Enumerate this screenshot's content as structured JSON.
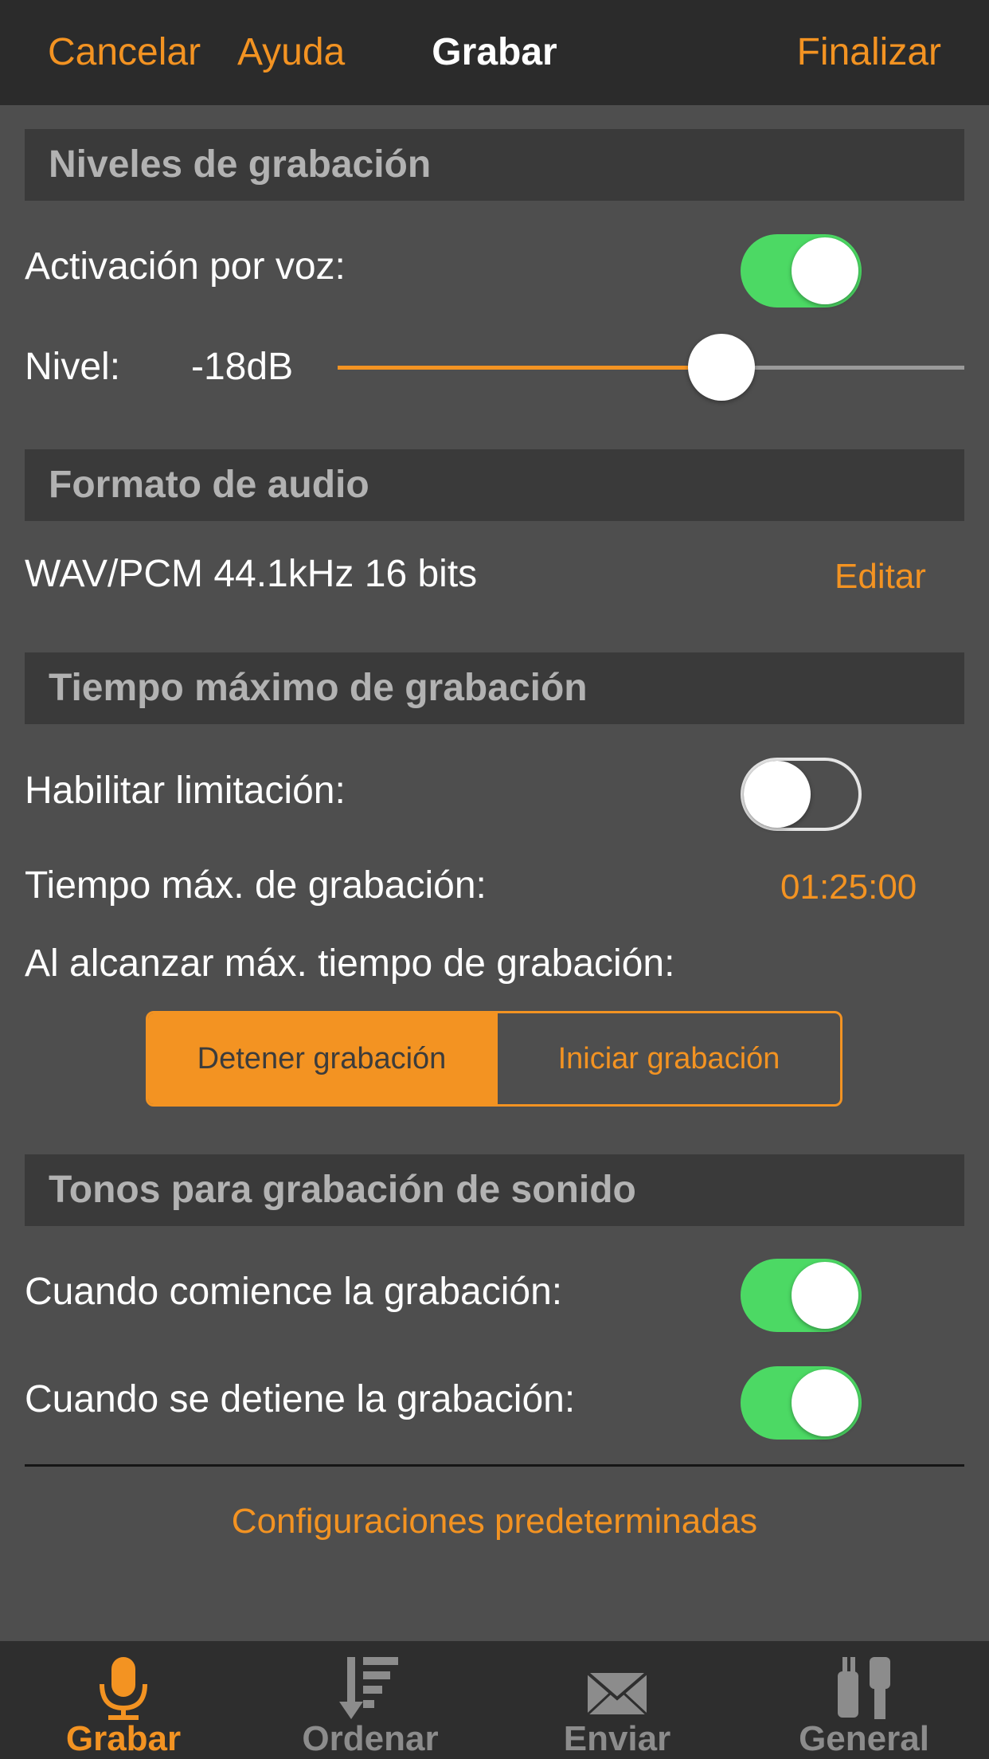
{
  "topbar": {
    "cancel_label": "Cancelar",
    "help_label": "Ayuda",
    "title": "Grabar",
    "finish_label": "Finalizar"
  },
  "levels": {
    "header": "Niveles de grabación",
    "voice_activation_label": "Activación por voz:",
    "voice_activation_on": true,
    "level_label": "Nivel:",
    "level_value": "-18dB"
  },
  "audio_format": {
    "header": "Formato de audio",
    "value": "WAV/PCM 44.1kHz 16 bits",
    "edit_label": "Editar"
  },
  "max_time": {
    "header": "Tiempo máximo de grabación",
    "enable_limit_label": "Habilitar limitación:",
    "enable_limit_on": false,
    "max_time_label": "Tiempo máx. de grabación:",
    "max_time_value": "01:25:00",
    "on_reach_label": "Al alcanzar máx. tiempo de grabación:",
    "options": [
      "Detener grabación",
      "Iniciar grabación"
    ],
    "selected_option": "Detener grabación"
  },
  "tones": {
    "header": "Tonos para grabación de sonido",
    "on_start_label": "Cuando comience la grabación:",
    "on_start_on": true,
    "on_stop_label": "Cuando se detiene la grabación:",
    "on_stop_on": true
  },
  "defaults_link": "Configuraciones predeterminadas",
  "tabbar": {
    "tabs": [
      {
        "label": "Grabar",
        "icon": "microphone-icon",
        "active": true
      },
      {
        "label": "Ordenar",
        "icon": "sort-icon",
        "active": false
      },
      {
        "label": "Enviar",
        "icon": "envelope-icon",
        "active": false
      },
      {
        "label": "General",
        "icon": "tools-icon",
        "active": false
      }
    ]
  },
  "colors": {
    "accent": "#f39322",
    "toggle_on": "#4cd964",
    "background": "#4e4e4e",
    "header_bg": "#3a3a3a",
    "bar_bg": "#2b2b2b"
  }
}
